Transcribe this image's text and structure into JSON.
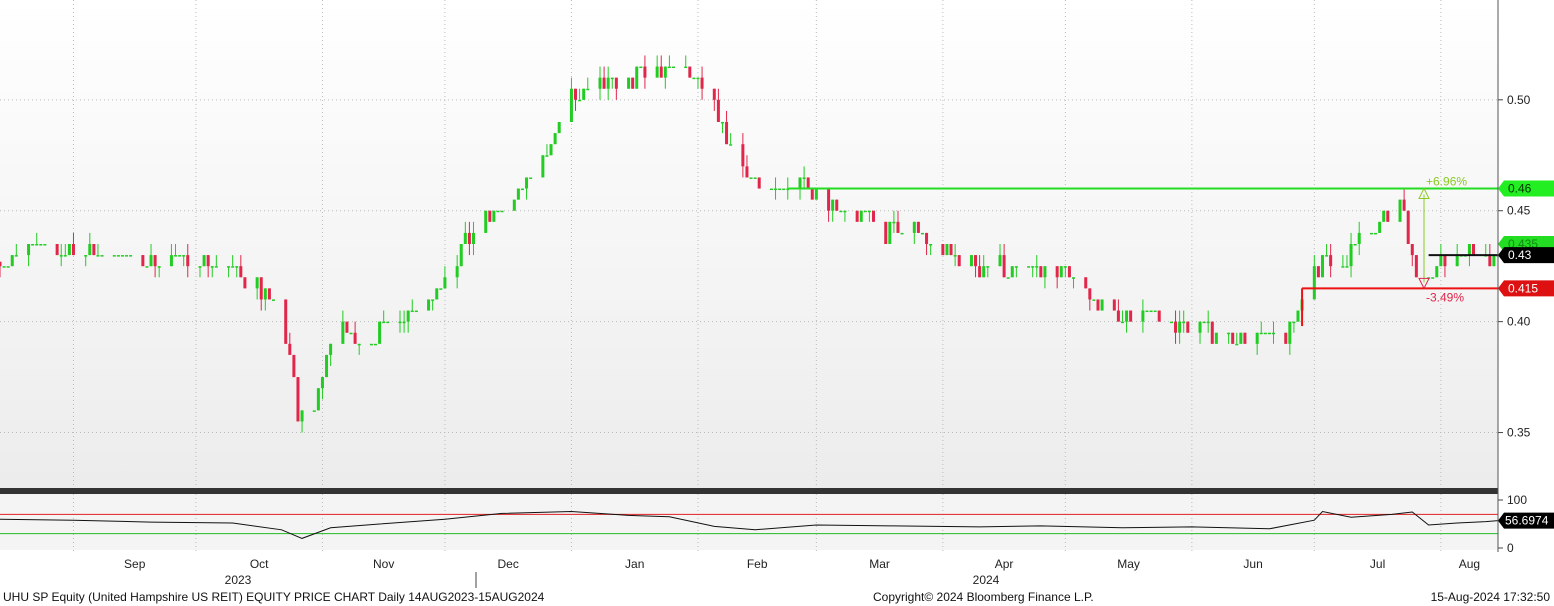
{
  "footer": {
    "left": "UHU SP Equity (United Hampshire US REIT) EQUITY PRICE CHART  Daily 14AUG2023-15AUG2024",
    "center": "Copyright© 2024 Bloomberg Finance L.P.",
    "right": "15-Aug-2024 17:32:50"
  },
  "colors": {
    "up": "#22cc22",
    "down": "#e0264a",
    "resistance": "#22dd22",
    "support": "#ee1111",
    "rsi_line": "#111111",
    "rsi_upper": "#dd2222",
    "rsi_lower": "#22bb22"
  },
  "chart_data": {
    "type": "candlestick",
    "title": "",
    "x_range": [
      "2023-08-14",
      "2024-08-15"
    ],
    "y_range": [
      0.325,
      0.545
    ],
    "y_ticks": [
      "0.35",
      "0.40",
      "0.45",
      "0.50"
    ],
    "month_labels": [
      "Sep",
      "Oct",
      "Nov",
      "Dec",
      "Jan",
      "Feb",
      "Mar",
      "Apr",
      "May",
      "Jun",
      "Jul",
      "Aug"
    ],
    "year_labels": [
      "2023",
      "2024"
    ],
    "grid": true,
    "price_path": [
      [
        "2023-08-14",
        0.427
      ],
      [
        "2023-08-21",
        0.432
      ],
      [
        "2023-08-28",
        0.433
      ],
      [
        "2023-09-04",
        0.431
      ],
      [
        "2023-09-11",
        0.43
      ],
      [
        "2023-09-18",
        0.428
      ],
      [
        "2023-09-25",
        0.427
      ],
      [
        "2023-10-02",
        0.428
      ],
      [
        "2023-10-09",
        0.425
      ],
      [
        "2023-10-16",
        0.418
      ],
      [
        "2023-10-20",
        0.405
      ],
      [
        "2023-10-24",
        0.385
      ],
      [
        "2023-10-26",
        0.355
      ],
      [
        "2023-10-30",
        0.36
      ],
      [
        "2023-11-02",
        0.385
      ],
      [
        "2023-11-06",
        0.398
      ],
      [
        "2023-11-10",
        0.39
      ],
      [
        "2023-11-14",
        0.395
      ],
      [
        "2023-11-20",
        0.403
      ],
      [
        "2023-11-27",
        0.41
      ],
      [
        "2023-12-04",
        0.43
      ],
      [
        "2023-12-11",
        0.445
      ],
      [
        "2023-12-18",
        0.455
      ],
      [
        "2023-12-25",
        0.475
      ],
      [
        "2024-01-01",
        0.5
      ],
      [
        "2024-01-08",
        0.505
      ],
      [
        "2024-01-15",
        0.51
      ],
      [
        "2024-01-22",
        0.512
      ],
      [
        "2024-01-29",
        0.515
      ],
      [
        "2024-02-05",
        0.495
      ],
      [
        "2024-02-12",
        0.47
      ],
      [
        "2024-02-19",
        0.455
      ],
      [
        "2024-02-26",
        0.465
      ],
      [
        "2024-03-04",
        0.455
      ],
      [
        "2024-03-11",
        0.448
      ],
      [
        "2024-03-18",
        0.44
      ],
      [
        "2024-03-25",
        0.44
      ],
      [
        "2024-04-01",
        0.432
      ],
      [
        "2024-04-08",
        0.425
      ],
      [
        "2024-04-15",
        0.425
      ],
      [
        "2024-04-22",
        0.423
      ],
      [
        "2024-04-29",
        0.422
      ],
      [
        "2024-05-06",
        0.412
      ],
      [
        "2024-05-13",
        0.402
      ],
      [
        "2024-05-20",
        0.405
      ],
      [
        "2024-05-27",
        0.4
      ],
      [
        "2024-06-03",
        0.397
      ],
      [
        "2024-06-10",
        0.395
      ],
      [
        "2024-06-17",
        0.392
      ],
      [
        "2024-06-24",
        0.393
      ],
      [
        "2024-07-01",
        0.425
      ],
      [
        "2024-07-08",
        0.428
      ],
      [
        "2024-07-15",
        0.44
      ],
      [
        "2024-07-22",
        0.455
      ],
      [
        "2024-07-26",
        0.42
      ],
      [
        "2024-08-01",
        0.428
      ],
      [
        "2024-08-08",
        0.432
      ],
      [
        "2024-08-15",
        0.43
      ]
    ],
    "resistance": {
      "value": 0.46,
      "label": "0.46",
      "pct_label": "+6.96%",
      "from": "2024-02-23"
    },
    "support": {
      "value": 0.415,
      "label": "0.415",
      "pct_label": "-3.49%",
      "from": "2024-06-28"
    },
    "last_price": {
      "value": 0.43,
      "label": "0.43"
    },
    "overlay_label": {
      "value": 0.435,
      "label": "0.435"
    },
    "rsi": {
      "ticks": [
        "100",
        "0"
      ],
      "upper": 70,
      "lower": 30,
      "last_label": "56.6974",
      "path": [
        [
          "2023-08-14",
          60
        ],
        [
          "2023-09-01",
          58
        ],
        [
          "2023-09-20",
          54
        ],
        [
          "2023-10-10",
          52
        ],
        [
          "2023-10-22",
          38
        ],
        [
          "2023-10-27",
          20
        ],
        [
          "2023-11-03",
          42
        ],
        [
          "2023-11-15",
          50
        ],
        [
          "2023-12-01",
          60
        ],
        [
          "2023-12-15",
          72
        ],
        [
          "2024-01-01",
          76
        ],
        [
          "2024-01-15",
          68
        ],
        [
          "2024-01-25",
          65
        ],
        [
          "2024-02-05",
          45
        ],
        [
          "2024-02-15",
          38
        ],
        [
          "2024-03-01",
          48
        ],
        [
          "2024-03-20",
          46
        ],
        [
          "2024-04-10",
          44
        ],
        [
          "2024-04-25",
          46
        ],
        [
          "2024-05-15",
          42
        ],
        [
          "2024-06-01",
          44
        ],
        [
          "2024-06-20",
          40
        ],
        [
          "2024-07-01",
          58
        ],
        [
          "2024-07-03",
          76
        ],
        [
          "2024-07-10",
          64
        ],
        [
          "2024-07-20",
          70
        ],
        [
          "2024-07-25",
          75
        ],
        [
          "2024-07-29",
          48
        ],
        [
          "2024-08-05",
          52
        ],
        [
          "2024-08-12",
          55
        ],
        [
          "2024-08-15",
          57
        ]
      ]
    }
  }
}
